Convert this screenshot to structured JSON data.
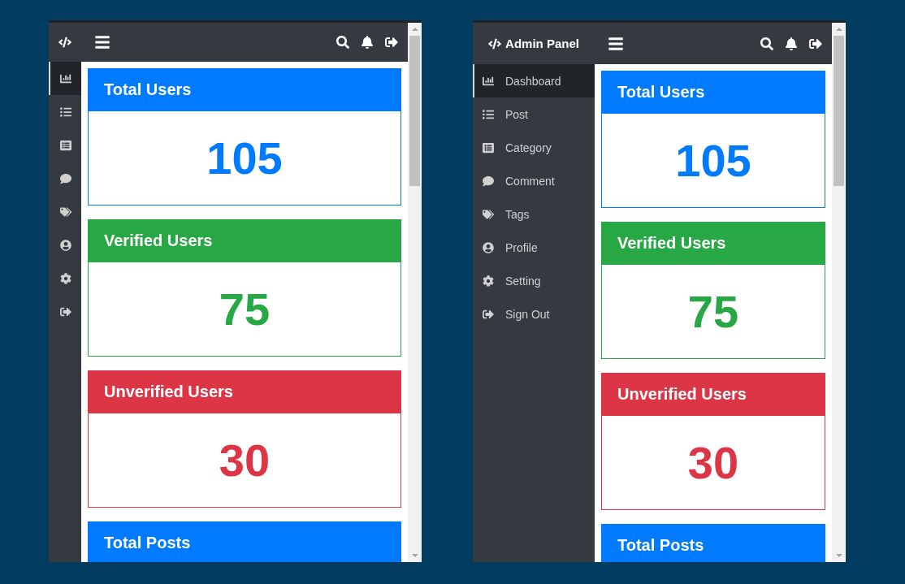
{
  "frames": [
    {
      "kind": "collapsed",
      "nav": [
        {
          "selected": true
        },
        {
          "selected": false
        },
        {
          "selected": false
        },
        {
          "selected": false
        },
        {
          "selected": false
        },
        {
          "selected": false
        },
        {
          "selected": false
        },
        {
          "selected": false
        }
      ],
      "cards": [
        {
          "title": "Total Users",
          "value": "105",
          "color": "#007bff"
        },
        {
          "title": "Verified Users",
          "value": "75",
          "color": "#28a745"
        },
        {
          "title": "Unverified Users",
          "value": "30",
          "color": "#dc3545"
        },
        {
          "title": "Total Posts",
          "color": "#007bff"
        }
      ]
    },
    {
      "kind": "expanded",
      "brand": "Admin Panel",
      "nav": [
        {
          "label": "Dashboard",
          "selected": true
        },
        {
          "label": "Post",
          "selected": false
        },
        {
          "label": "Category",
          "selected": false
        },
        {
          "label": "Comment",
          "selected": false
        },
        {
          "label": "Tags",
          "selected": false
        },
        {
          "label": "Profile",
          "selected": false
        },
        {
          "label": "Setting",
          "selected": false
        },
        {
          "label": "Sign Out",
          "selected": false
        }
      ],
      "cards": [
        {
          "title": "Total Users",
          "value": "105",
          "color": "#007bff"
        },
        {
          "title": "Verified Users",
          "value": "75",
          "color": "#28a745"
        },
        {
          "title": "Unverified Users",
          "value": "30",
          "color": "#dc3545"
        },
        {
          "title": "Total Posts",
          "color": "#007bff"
        }
      ]
    }
  ]
}
